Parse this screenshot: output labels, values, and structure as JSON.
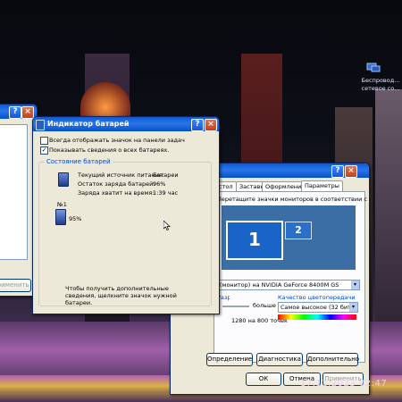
{
  "desktop": {
    "icon_label": "Беспровод... сетевое со...",
    "timestamp": "17.11.2023 02:47"
  },
  "battery_window": {
    "title": "Индикатор батарей",
    "always_show_label": "Всегда отображать значок на панели задач",
    "show_details_label": "Показывать сведения о всех батареях.",
    "status_group": "Состояние батарей",
    "source_label": "Текущий источник питания:",
    "source_value": "Батареи",
    "remaining_label": "Остаток заряда батарей:",
    "remaining_value": "96%",
    "time_label": "Заряда хватит на время:",
    "time_value": "1:39 час",
    "battery_number": "№1",
    "battery_percent": "95%",
    "hint": "Чтобы получить дополнительные сведения, щелкните значок нужной батареи.",
    "always_checked": false,
    "details_checked": true
  },
  "left_window": {
    "apply_button": "Применить"
  },
  "display_window": {
    "tabs": [
      "стол",
      "Заставка",
      "Оформление",
      "Параметры"
    ],
    "drag_hint": "Перетащите значки мониторов в соответствии с их расположением.",
    "monitor1": "1",
    "monitor2": "2",
    "display_select": "(монитор) на NVIDIA GeForce 8400M GS",
    "resolution_group": "Разрешение экрана",
    "resolution_more": "больше",
    "resolution_value": "1280 на 800 точек",
    "color_group": "Качество цветопередачи",
    "color_value": "Самое высокое (32 бита)",
    "troubleshoot_button": "Определение",
    "diagnostics_button": "Диагностика",
    "advanced_button": "Дополнительно",
    "ok_button": "ОК",
    "cancel_button": "Отмена",
    "apply_button": "Применить"
  }
}
